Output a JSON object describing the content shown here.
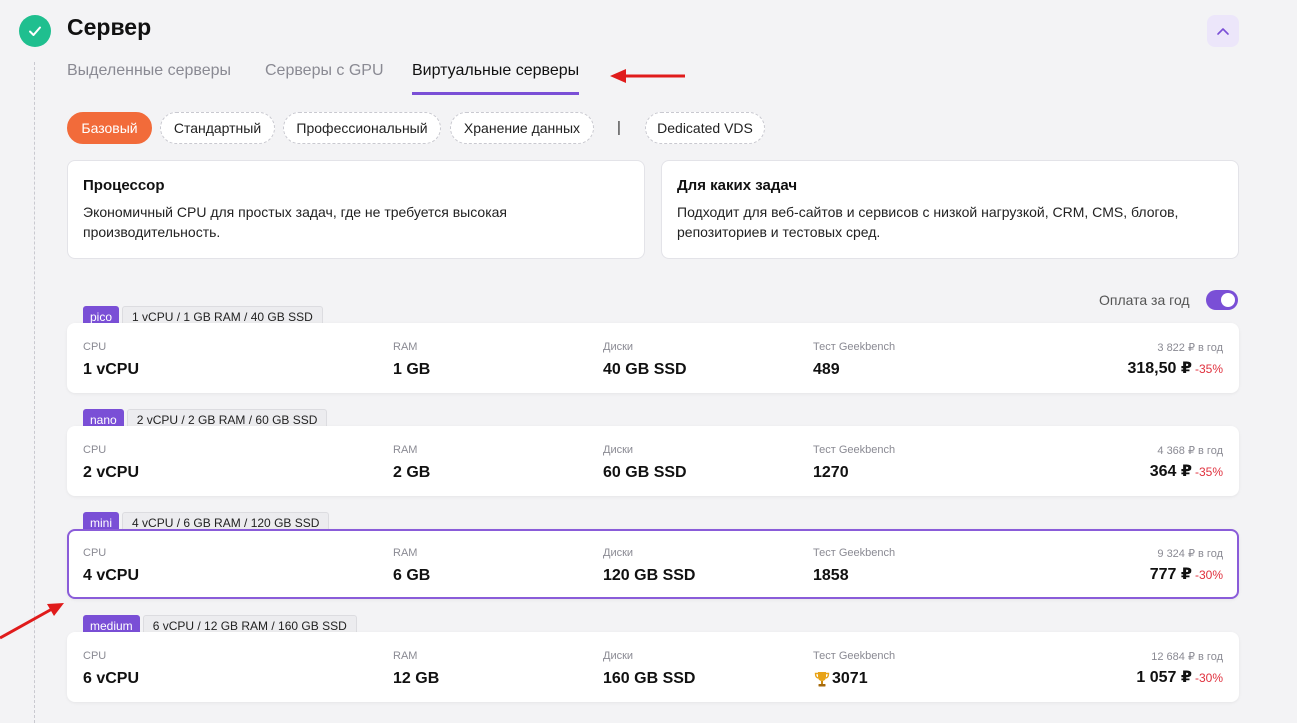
{
  "header": {
    "title": "Сервер"
  },
  "tabs": [
    {
      "label": "Выделенные серверы"
    },
    {
      "label": "Серверы с GPU"
    },
    {
      "label": "Виртуальные серверы"
    }
  ],
  "filters": [
    {
      "label": "Базовый"
    },
    {
      "label": "Стандартный"
    },
    {
      "label": "Профессиональный"
    },
    {
      "label": "Хранение данных"
    },
    {
      "label": "Dedicated VDS"
    }
  ],
  "filter_separator": "|",
  "info": {
    "processor": {
      "title": "Процессор",
      "text": "Экономичный CPU для простых задач, где не требуется высокая производительность."
    },
    "tasks": {
      "title": "Для каких задач",
      "text": "Подходит для веб-сайтов и сервисов с низкой нагрузкой, CRM, CMS, блогов, репозиториев и тестовых сред."
    }
  },
  "billing": {
    "label": "Оплата за год",
    "enabled": true
  },
  "column_labels": {
    "cpu": "CPU",
    "ram": "RAM",
    "disks": "Диски",
    "bench": "Тест Geekbench"
  },
  "plans": [
    {
      "name": "pico",
      "spec": "1 vCPU / 1 GB RAM / 40 GB SSD",
      "cpu": "1 vCPU",
      "ram": "1 GB",
      "disk": "40 GB SSD",
      "bench": "489",
      "old_price": "3 822 ₽ в год",
      "price": "318,50 ₽",
      "discount": "-35%",
      "selected": false,
      "trophy": false
    },
    {
      "name": "nano",
      "spec": "2 vCPU / 2 GB RAM / 60 GB SSD",
      "cpu": "2 vCPU",
      "ram": "2 GB",
      "disk": "60 GB SSD",
      "bench": "1270",
      "old_price": "4 368 ₽ в год",
      "price": "364 ₽",
      "discount": "-35%",
      "selected": false,
      "trophy": false
    },
    {
      "name": "mini",
      "spec": "4 vCPU / 6 GB RAM / 120 GB SSD",
      "cpu": "4 vCPU",
      "ram": "6 GB",
      "disk": "120 GB SSD",
      "bench": "1858",
      "old_price": "9 324 ₽ в год",
      "price": "777 ₽",
      "discount": "-30%",
      "selected": true,
      "trophy": false
    },
    {
      "name": "medium",
      "spec": "6 vCPU / 12 GB RAM / 160 GB SSD",
      "cpu": "6 vCPU",
      "ram": "12 GB",
      "disk": "160 GB SSD",
      "bench": "3071",
      "old_price": "12 684 ₽ в год",
      "price": "1 057 ₽",
      "discount": "-30%",
      "selected": false,
      "trophy": true
    }
  ],
  "colors": {
    "accent": "#7a4fd6",
    "active_filter": "#f26b3a",
    "check": "#1fbf8f",
    "discount": "#e0313e",
    "annotation_arrow": "#e01b1b"
  }
}
